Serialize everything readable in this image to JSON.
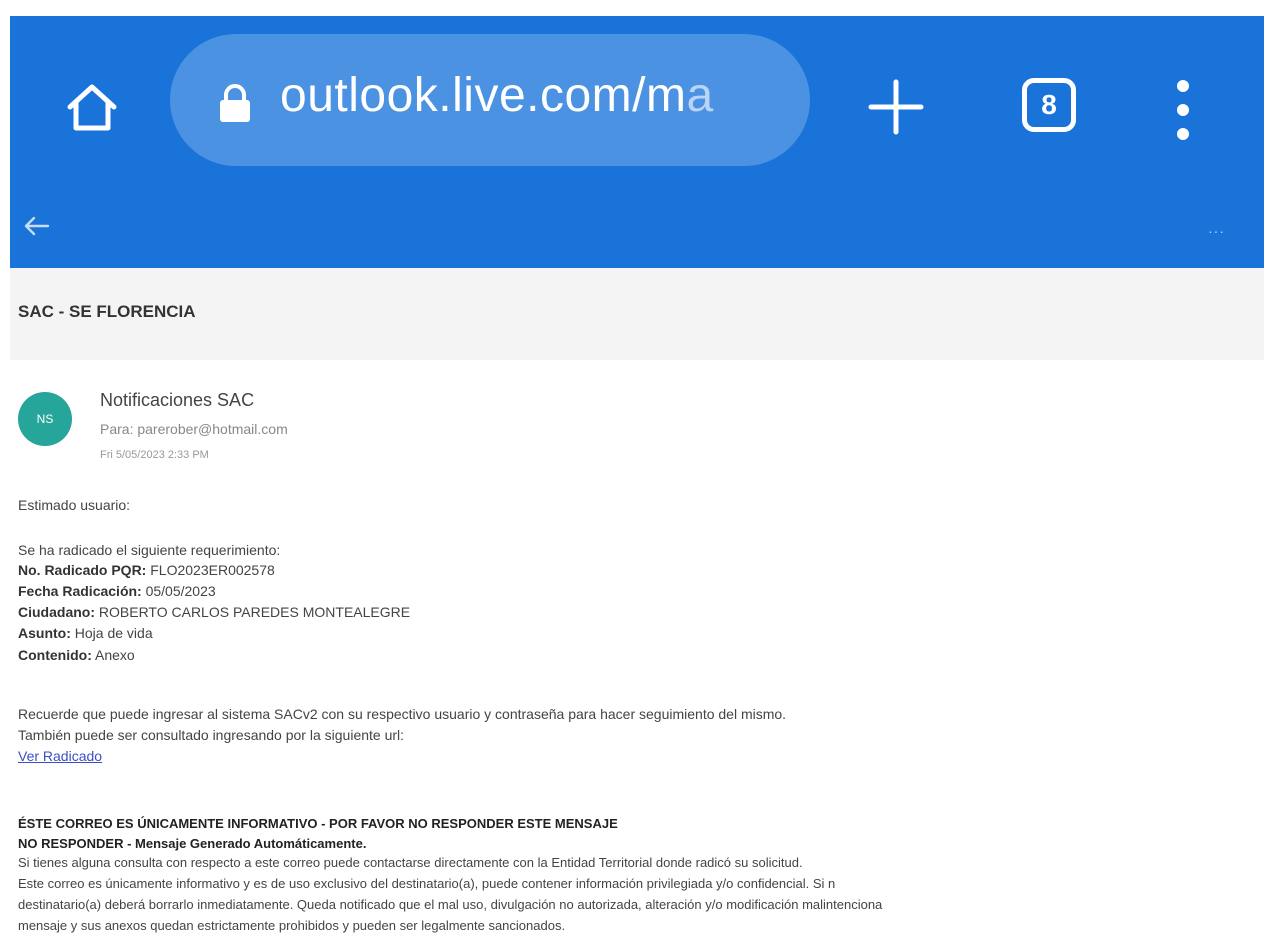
{
  "browser": {
    "url_main": "outlook.live.com/m",
    "url_faded": "a",
    "tab_count": "8",
    "toolbar_color": "#1a73d9"
  },
  "mail": {
    "more_label": "···",
    "subject": "SAC - SE FLORENCIA",
    "avatar_initials": "NS",
    "avatar_color": "#26a69a",
    "sender": "Notificaciones SAC",
    "to": "Para: parerober@hotmail.com",
    "date": "Fri 5/05/2023 2:33 PM",
    "greeting": "Estimado usuario:",
    "intro": "Se ha radicado el siguiente requerimiento:",
    "fields": [
      {
        "label": "No. Radicado PQR:",
        "value": " FLO2023ER002578"
      },
      {
        "label": "Fecha Radicación:",
        "value": " 05/05/2023"
      },
      {
        "label": "Ciudadano:",
        "value": " ROBERTO CARLOS PAREDES MONTEALEGRE"
      },
      {
        "label": "Asunto:",
        "value": " Hoja de vida"
      },
      {
        "label": "Contenido:",
        "value": " Anexo"
      }
    ],
    "reminder": "Recuerde que puede ingresar al sistema SACv2 con su respectivo usuario y contraseña para hacer seguimiento del mismo.",
    "url_note": "También puede ser consultado ingresando por la siguiente url:",
    "link_label": "Ver Radicado",
    "disclaimer_title": "ÉSTE CORREO ES ÚNICAMENTE INFORMATIVO - POR FAVOR NO RESPONDER ESTE MENSAJE",
    "disclaimer_subtitle": "NO RESPONDER - Mensaje Generado Automáticamente.",
    "disclaimer_lines": [
      "Si tienes alguna consulta con respecto a este correo puede contactarse directamente con la Entidad Territorial donde radicó su solicitud.",
      "Este correo es únicamente informativo y es de uso exclusivo del destinatario(a), puede contener información privilegiada y/o confidencial. Si n",
      "destinatario(a) deberá borrarlo inmediatamente. Queda notificado que el mal uso, divulgación no autorizada, alteración y/o modificación malintenciona",
      "mensaje y sus anexos quedan estrictamente prohibidos y pueden ser legalmente sancionados."
    ]
  }
}
